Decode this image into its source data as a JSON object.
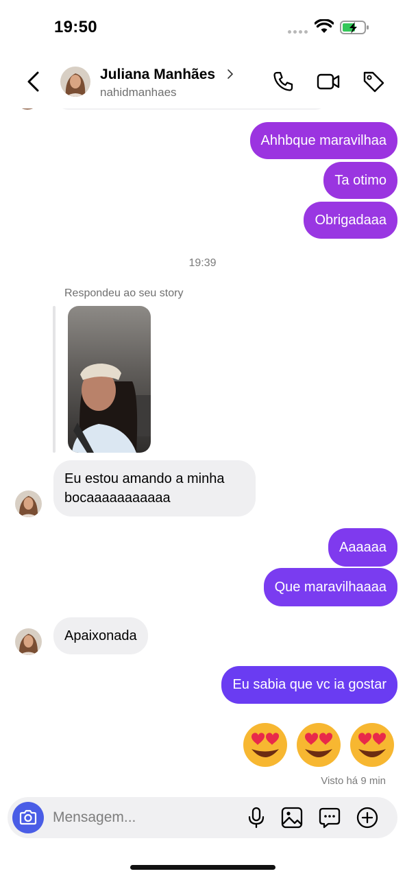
{
  "status_bar": {
    "time": "19:50"
  },
  "header": {
    "name": "Juliana Manhães",
    "username": "nahidmanhaes",
    "icons": [
      "back-arrow-icon",
      "phone-icon",
      "video-camera-icon",
      "tag-icon"
    ]
  },
  "colors": {
    "bubble_purple": "#9b34e0",
    "bubble_violet": "#6a3cf2",
    "incoming_bubble": "#efeff1",
    "camera_button": "#4a5de6"
  },
  "messages": {
    "m1": "Ahhbque maravilhaa",
    "m2": "Ta otimo",
    "m3": "Obrigadaaa",
    "timestamp": "19:39",
    "story_reply_label": "Respondeu ao seu story",
    "m4": "Eu estou amando a minha bocaaaaaaaaaaa",
    "m5": "Aaaaaa",
    "m6": "Que maravilhaaaa",
    "m7": "Apaixonada",
    "m8": "Eu sabia que vc ia gostar",
    "emojis": [
      "😍",
      "😍",
      "😍"
    ],
    "seen": "Visto há 9 min"
  },
  "composer": {
    "placeholder": "Mensagem...",
    "icons": [
      "camera-icon",
      "microphone-icon",
      "image-icon",
      "sticker-icon",
      "plus-icon"
    ]
  }
}
